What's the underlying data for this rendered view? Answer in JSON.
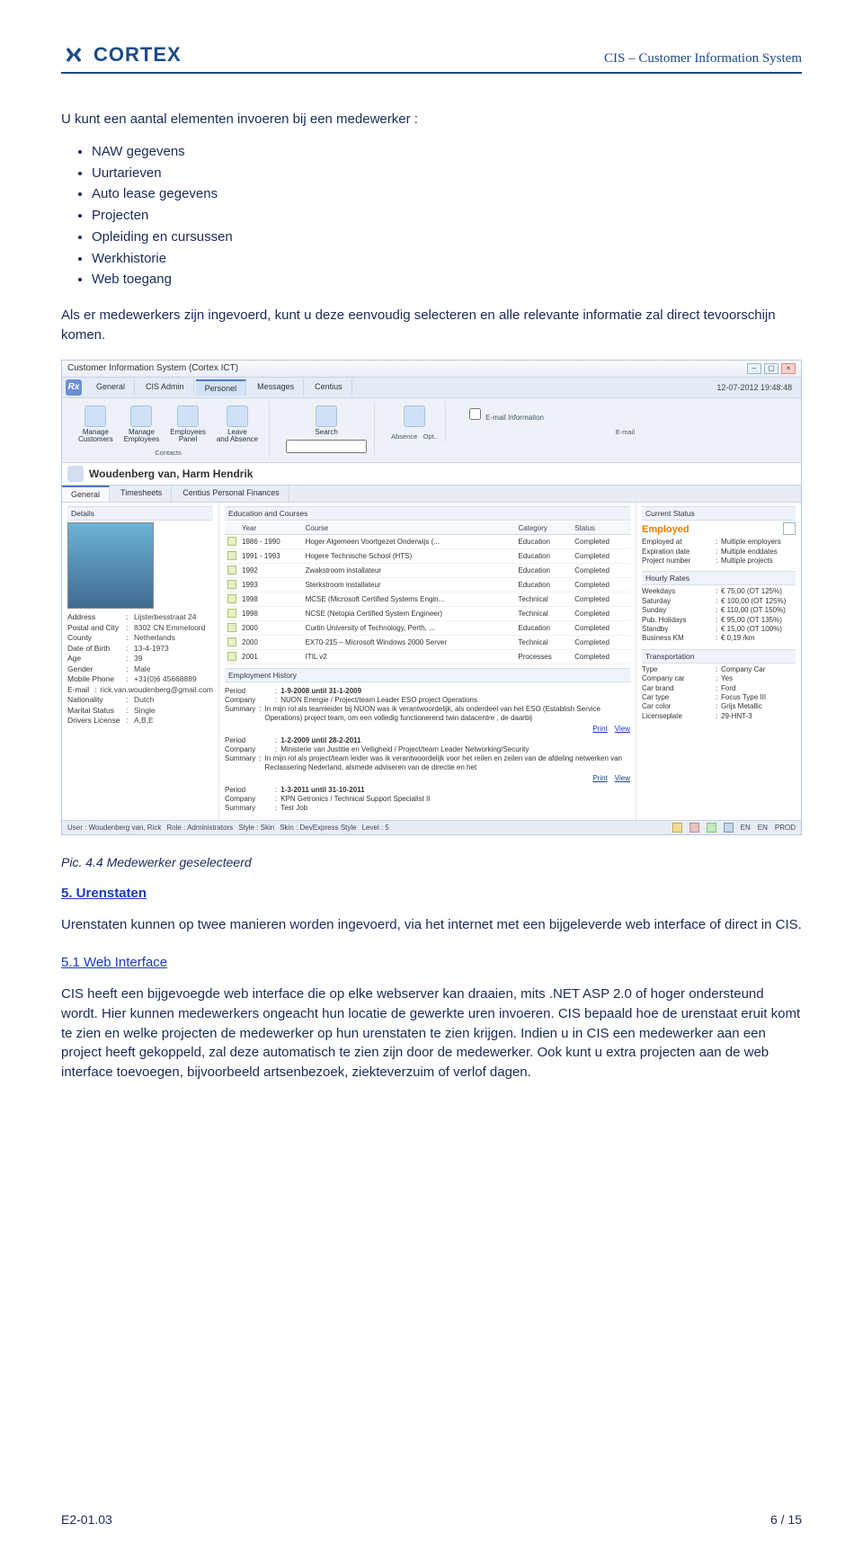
{
  "header": {
    "logo_text": "CORTEX",
    "subtitle": "CIS – Customer Information System"
  },
  "intro": "U kunt een aantal elementen invoeren bij een medewerker :",
  "bullets": [
    "NAW gegevens",
    "Uurtarieven",
    "Auto lease gegevens",
    "Projecten",
    "Opleiding en cursussen",
    "Werkhistorie",
    "Web toegang"
  ],
  "intro2": "Als er medewerkers zijn ingevoerd, kunt u deze eenvoudig selecteren en alle relevante informatie zal direct tevoorschijn komen.",
  "caption": "Pic. 4.4 Medewerker  geselecteerd",
  "sec5_title": "5. Urenstaten",
  "sec5_text": "Urenstaten kunnen op twee manieren worden ingevoerd, via het internet met een bijgeleverde web interface of direct in CIS.",
  "sec51_title": "5.1 Web Interface",
  "sec51_text": "CIS heeft een bijgevoegde web interface die op elke webserver kan draaien, mits .NET ASP 2.0 of hoger ondersteund wordt. Hier kunnen medewerkers ongeacht hun locatie de gewerkte uren invoeren. CIS bepaald hoe de urenstaat eruit komt te zien en welke projecten de medewerker op hun urenstaten te zien krijgen. Indien u in CIS een medewerker aan een project heeft gekoppeld, zal deze automatisch te zien zijn door de medewerker. Ook kunt u extra projecten aan de web interface toevoegen, bijvoorbeeld artsenbezoek, ziekteverzuim of verlof dagen.",
  "footer_left": "E2-01.03",
  "footer_right": "6 / 15",
  "shot": {
    "window_title": "Customer Information System (Cortex ICT)",
    "datetime": "12-07-2012    19:48:48",
    "topnav": [
      "General",
      "CIS Admin",
      "Personel",
      "Messages",
      "Centius"
    ],
    "topnav_active_index": 2,
    "ribbon_groups": {
      "contacts": {
        "buttons": [
          "Manage Customers",
          "Manage Employees",
          "Employees Panel",
          "Leave and Absence"
        ],
        "label": "Contacts"
      },
      "search": {
        "button": "Search"
      },
      "absence": {
        "label": "Absence",
        "sub": "Opt.."
      },
      "email": {
        "checkbox": "E-mail Information",
        "label": "E-mail"
      }
    },
    "employee_name": "Woudenberg van, Harm Hendrik",
    "emp_tabs": [
      "General",
      "Timesheets",
      "Centius Personal Finances"
    ],
    "col1": {
      "details_hd": "Details",
      "kv": [
        {
          "k": "Address",
          "v": "Lijsterbesstraat 24"
        },
        {
          "k": "Postal and City",
          "v": "8302 CN Emmeloord"
        },
        {
          "k": "County",
          "v": "Netherlands"
        },
        {
          "k": "",
          "v": ""
        },
        {
          "k": "Date of Birth",
          "v": "13-4-1973"
        },
        {
          "k": "Age",
          "v": "39"
        },
        {
          "k": "Gender",
          "v": "Male"
        },
        {
          "k": "Mobile Phone",
          "v": "+31(0)6 45668889"
        },
        {
          "k": "E-mail",
          "v": "rick.van.woudenberg@gmail.com"
        },
        {
          "k": "",
          "v": ""
        },
        {
          "k": "Nationality",
          "v": "Dutch"
        },
        {
          "k": "Marital Status",
          "v": "Single"
        },
        {
          "k": "Drivers License",
          "v": "A,B,E"
        }
      ]
    },
    "col2": {
      "edu_hd": "Education and Courses",
      "edu_cols": [
        "Year",
        "Course",
        "Category",
        "Status"
      ],
      "edu_rows": [
        {
          "y": "1986 - 1990",
          "c": "Hoger Algemeen Voortgezet Onderwijs (...",
          "cat": "Education",
          "s": "Completed"
        },
        {
          "y": "1991 - 1993",
          "c": "Hogere Technische School (HTS)",
          "cat": "Education",
          "s": "Completed"
        },
        {
          "y": "1992",
          "c": "Zwakstroom installateur",
          "cat": "Education",
          "s": "Completed"
        },
        {
          "y": "1993",
          "c": "Sterkstroom installateur",
          "cat": "Education",
          "s": "Completed"
        },
        {
          "y": "1998",
          "c": "MCSE (Microsoft Certified Systems Engin...",
          "cat": "Technical",
          "s": "Completed"
        },
        {
          "y": "1998",
          "c": "NCSE (Netopia Certified System Engineer)",
          "cat": "Technical",
          "s": "Completed"
        },
        {
          "y": "2000",
          "c": "Curtin University of Technology, Perth, ...",
          "cat": "Education",
          "s": "Completed"
        },
        {
          "y": "2000",
          "c": "EX70-215 – Microsoft Windows 2000 Server",
          "cat": "Technical",
          "s": "Completed"
        },
        {
          "y": "2001",
          "c": "ITIL v2",
          "cat": "Processes",
          "s": "Completed"
        }
      ],
      "hist_hd": "Employment History",
      "hist_items": [
        {
          "period": "1-9-2008 until 31-1-2009",
          "company": "NUON Energie / Project/team Leader ESO project Operations",
          "summary": "In mijn rol als teamleider bij NUON was ik verantwoordelijk, als onderdeel van het ESO (Establish Service Operations) project team, om een volledig functionerend twin datacentre , de daarbij"
        },
        {
          "period": "1-2-2009 until 28-2-2011",
          "company": "Ministerie van Justitie en Veiligheid / Project/team Leader Networking/Security",
          "summary": "In mijn rol als project/team leider was ik verantwoordelijk voor het reilen en zeilen van de afdeling netwerken van Reclassering Nederland, alsmede adviseren van de directie en het"
        },
        {
          "period": "1-3-2011 until 31-10-2011",
          "company": "KPN Getronics / Technical Support Specialist II",
          "summary": "Test Job"
        }
      ],
      "print": "Print",
      "view": "View"
    },
    "col3": {
      "status_hd": "Current Status",
      "employed": "Employed",
      "status_kv": [
        {
          "k": "Employed at",
          "v": "Multiple employers"
        },
        {
          "k": "Expiration date",
          "v": "Multiple enddates"
        },
        {
          "k": "Project number",
          "v": "Multiple projects"
        }
      ],
      "rates_hd": "Hourly Rates",
      "rates_kv": [
        {
          "k": "Weekdays",
          "v": "€ 75,00 (OT 125%)"
        },
        {
          "k": "Saturday",
          "v": "€ 100,00 (OT 125%)"
        },
        {
          "k": "Sunday",
          "v": "€ 110,00 (OT 150%)"
        },
        {
          "k": "Pub. Holidays",
          "v": "€ 95,00 (OT 135%)"
        },
        {
          "k": "Standby",
          "v": "€ 15,00 (OT 100%)"
        },
        {
          "k": "Business KM",
          "v": "€ 0,19 /km"
        }
      ],
      "trans_hd": "Transportation",
      "trans_kv": [
        {
          "k": "Type",
          "v": "Company Car"
        },
        {
          "k": "Company car",
          "v": "Yes"
        },
        {
          "k": "Car brand",
          "v": "Ford"
        },
        {
          "k": "Car type",
          "v": "Focus Type III"
        },
        {
          "k": "Car color",
          "v": "Grijs Metallic"
        },
        {
          "k": "Licenseplate",
          "v": "29-HNT-3"
        }
      ]
    },
    "statusbar": {
      "user_lbl": "User :",
      "user": "Woudenberg van, Rick",
      "role_lbl": "Role :",
      "role": "Administrators",
      "style_lbl": "Style :",
      "style": "Skin",
      "skin_lbl": "Skin :",
      "skin": "DevExpress Style",
      "level_lbl": "Level :",
      "level": "5",
      "right": [
        "EN",
        "EN",
        "PROD"
      ]
    }
  }
}
